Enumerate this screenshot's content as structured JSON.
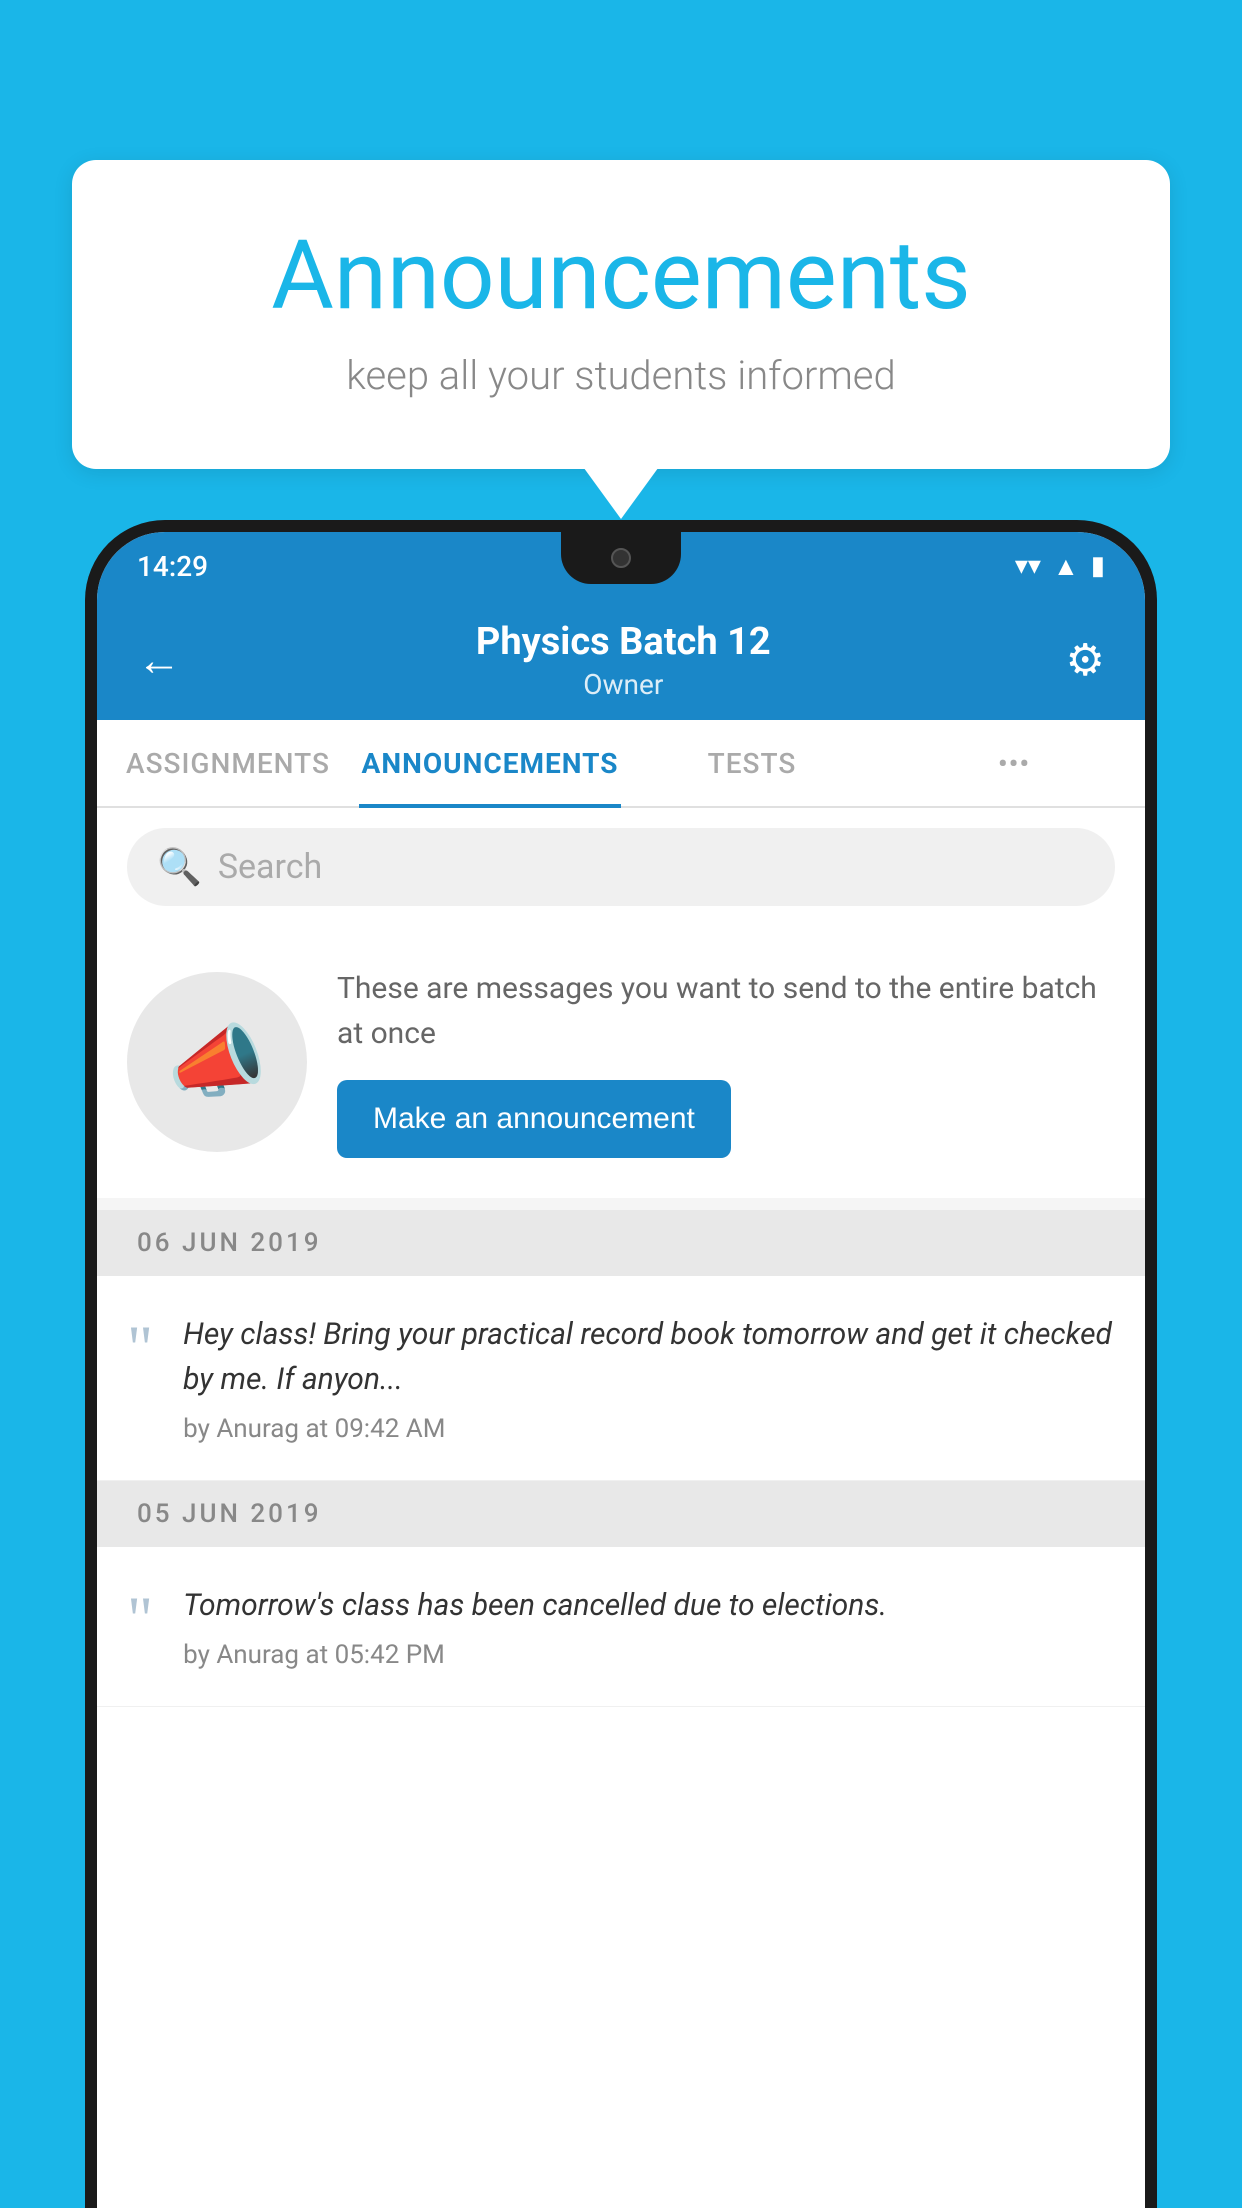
{
  "background_color": "#1ab6e8",
  "speech_bubble": {
    "title": "Announcements",
    "subtitle": "keep all your students informed"
  },
  "status_bar": {
    "time": "14:29",
    "icons": [
      "wifi",
      "signal",
      "battery"
    ]
  },
  "app_header": {
    "title": "Physics Batch 12",
    "subtitle": "Owner",
    "back_label": "←",
    "gear_label": "⚙"
  },
  "tabs": [
    {
      "label": "ASSIGNMENTS",
      "active": false
    },
    {
      "label": "ANNOUNCEMENTS",
      "active": true
    },
    {
      "label": "TESTS",
      "active": false
    },
    {
      "label": "•••",
      "active": false
    }
  ],
  "search": {
    "placeholder": "Search"
  },
  "announce_prompt": {
    "description": "These are messages you want to send to the entire batch at once",
    "button_label": "Make an announcement"
  },
  "announcements": [
    {
      "date": "06  JUN  2019",
      "messages": [
        {
          "text": "Hey class! Bring your practical record book tomorrow and get it checked by me. If anyon...",
          "author": "by Anurag at 09:42 AM"
        }
      ]
    },
    {
      "date": "05  JUN  2019",
      "messages": [
        {
          "text": "Tomorrow's class has been cancelled due to elections.",
          "author": "by Anurag at 05:42 PM"
        }
      ]
    }
  ]
}
